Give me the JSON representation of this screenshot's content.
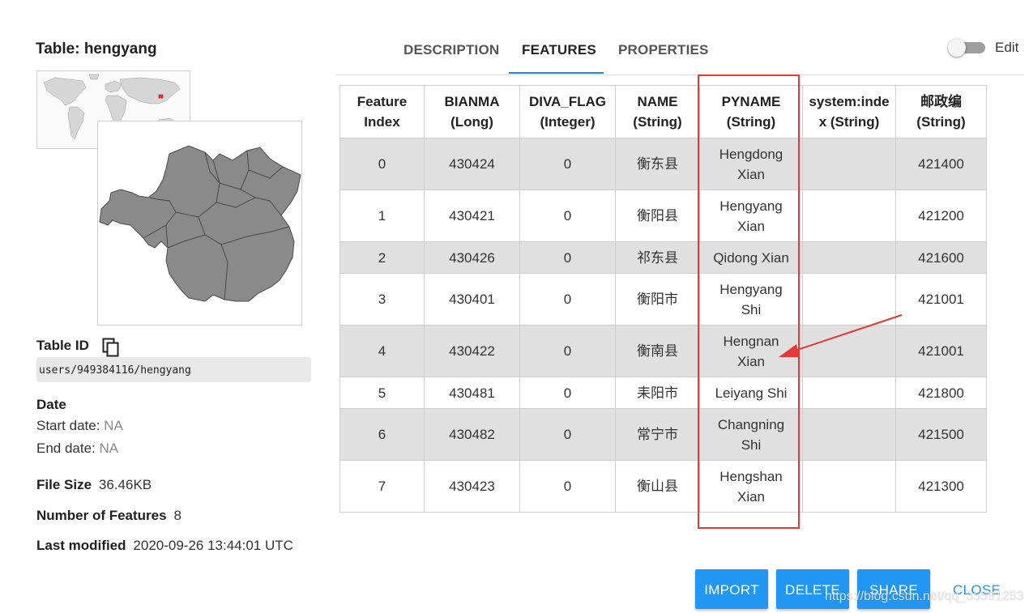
{
  "left_panel": {
    "title": "Table: hengyang",
    "table_id_label": "Table ID",
    "table_id_value": "users/949384116/hengyang",
    "date_label": "Date",
    "start_date_label": "Start date:",
    "start_date_value": "NA",
    "end_date_label": "End date:",
    "end_date_value": "NA",
    "file_size_label": "File Size",
    "file_size_value": "36.46KB",
    "num_features_label": "Number of Features",
    "num_features_value": "8",
    "last_modified_label": "Last modified",
    "last_modified_value": "2020-09-26 13:44:01 UTC"
  },
  "tabs": {
    "description": "DESCRIPTION",
    "features": "FEATURES",
    "properties": "PROPERTIES",
    "active": "FEATURES"
  },
  "edit": {
    "label": "Edit",
    "enabled": false
  },
  "table": {
    "headers": [
      [
        "Feature",
        "Index"
      ],
      [
        "BIANMA",
        "(Long)"
      ],
      [
        "DIVA_FLAG",
        "(Integer)"
      ],
      [
        "NAME",
        "(String)"
      ],
      [
        "PYNAME",
        "(String)"
      ],
      [
        "system:inde",
        "x (String)"
      ],
      [
        "邮政编",
        "(String)"
      ]
    ],
    "rows": [
      {
        "index": "0",
        "bianma": "430424",
        "diva_flag": "0",
        "name": "衡东县",
        "pyname": [
          "Hengdong",
          "Xian"
        ],
        "system_index": "",
        "postal": "421400"
      },
      {
        "index": "1",
        "bianma": "430421",
        "diva_flag": "0",
        "name": "衡阳县",
        "pyname": [
          "Hengyang",
          "Xian"
        ],
        "system_index": "",
        "postal": "421200"
      },
      {
        "index": "2",
        "bianma": "430426",
        "diva_flag": "0",
        "name": "祁东县",
        "pyname": [
          "Qidong Xian"
        ],
        "system_index": "",
        "postal": "421600"
      },
      {
        "index": "3",
        "bianma": "430401",
        "diva_flag": "0",
        "name": "衡阳市",
        "pyname": [
          "Hengyang",
          "Shi"
        ],
        "system_index": "",
        "postal": "421001"
      },
      {
        "index": "4",
        "bianma": "430422",
        "diva_flag": "0",
        "name": "衡南县",
        "pyname": [
          "Hengnan",
          "Xian"
        ],
        "system_index": "",
        "postal": "421001"
      },
      {
        "index": "5",
        "bianma": "430481",
        "diva_flag": "0",
        "name": "耒阳市",
        "pyname": [
          "Leiyang Shi"
        ],
        "system_index": "",
        "postal": "421800"
      },
      {
        "index": "6",
        "bianma": "430482",
        "diva_flag": "0",
        "name": "常宁市",
        "pyname": [
          "Changning",
          "Shi"
        ],
        "system_index": "",
        "postal": "421500"
      },
      {
        "index": "7",
        "bianma": "430423",
        "diva_flag": "0",
        "name": "衡山县",
        "pyname": [
          "Hengshan",
          "Xian"
        ],
        "system_index": "",
        "postal": "421300"
      }
    ]
  },
  "annotations": {
    "highlight_color": "#e53935"
  },
  "buttons": {
    "import": "IMPORT",
    "delete": "DELETE",
    "share": "SHARE",
    "close": "CLOSE"
  },
  "watermark": "https://blog.csdn.net/qq_35591253",
  "colors": {
    "accent": "#2196f3",
    "tab_underline": "#1e88e5",
    "row_shade": "#e0e0e0"
  },
  "icons": {
    "copy": "copy-icon",
    "world_map": "world-map-thumbnail",
    "region_map": "region-map-thumbnail"
  }
}
